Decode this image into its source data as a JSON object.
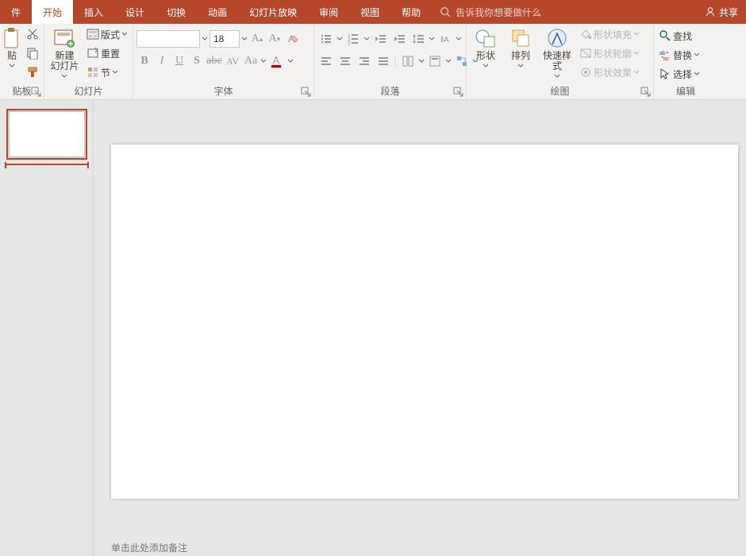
{
  "colors": {
    "accent": "#b7472a"
  },
  "tabs": {
    "file": "件",
    "home": "开始",
    "insert": "插入",
    "design": "设计",
    "transitions": "切换",
    "animations": "动画",
    "slideshow": "幻灯片放映",
    "review": "审阅",
    "view": "视图",
    "help": "帮助"
  },
  "tellme": {
    "placeholder": "告诉我你想要做什么"
  },
  "share": {
    "label": "共享"
  },
  "groups": {
    "clipboard": {
      "title": "贴板",
      "paste": "贴"
    },
    "slides": {
      "title": "幻灯片",
      "new_slide": "新建\n幻灯片",
      "layout": "版式",
      "reset": "重置",
      "section": "节"
    },
    "font": {
      "title": "字体",
      "name": "",
      "size": "18"
    },
    "paragraph": {
      "title": "段落"
    },
    "drawing": {
      "title": "绘图",
      "shapes": "形状",
      "arrange": "排列",
      "quick_styles": "快速样式",
      "shape_fill": "形状填充",
      "shape_outline": "形状轮廓",
      "shape_effects": "形状效果"
    },
    "editing": {
      "title": "编辑",
      "find": "查找",
      "replace": "替换",
      "select": "选择"
    }
  },
  "notes_hint": "单击此处添加备注"
}
